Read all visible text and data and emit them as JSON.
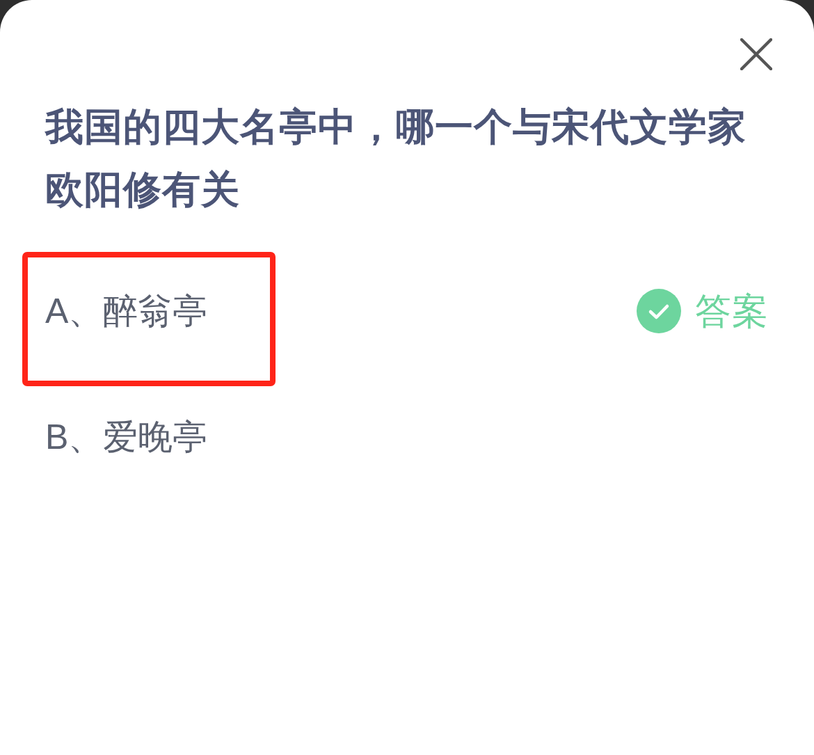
{
  "question": "我国的四大名亭中，哪一个与宋代文学家欧阳修有关",
  "answer_label": "答案",
  "options": [
    {
      "label": "A、醉翁亭",
      "highlighted": true,
      "correct": true
    },
    {
      "label": "B、爱晚亭",
      "highlighted": false,
      "correct": false
    }
  ]
}
